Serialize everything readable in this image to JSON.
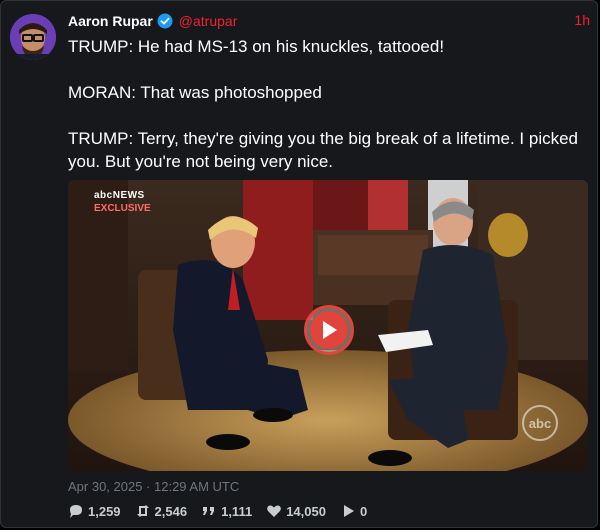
{
  "author": {
    "name": "Aaron Rupar",
    "handle": "@atrupar"
  },
  "post": {
    "time_ago": "1h",
    "paragraphs": [
      "TRUMP: He had MS-13 on his knuckles, tattooed!",
      "MORAN: That was photoshopped",
      "TRUMP: Terry, they're giving you the big break of a lifetime. I picked you. But you're not being very nice."
    ],
    "timestamp": "Apr 30, 2025 · 12:29 AM UTC"
  },
  "video": {
    "badge_network": "abcNEWS",
    "badge_tag": "EXCLUSIVE",
    "watermark": "abc"
  },
  "stats": {
    "replies": "1,259",
    "reposts": "2,546",
    "quotes": "1,111",
    "likes": "14,050",
    "views": "0"
  },
  "colors": {
    "accent": "#f4212e",
    "play": "#e0443a",
    "verified": "#1d9bf0"
  }
}
